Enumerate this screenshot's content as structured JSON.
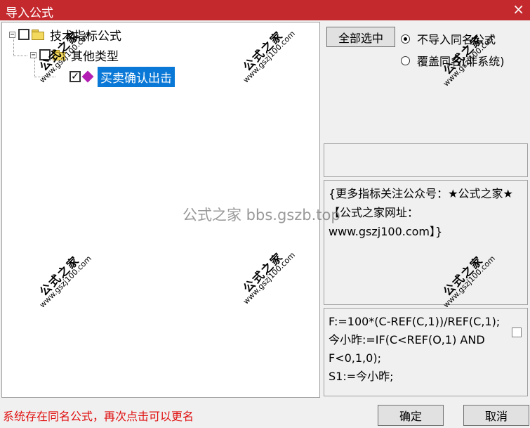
{
  "window": {
    "title": "导入公式",
    "close_glyph": "×"
  },
  "tree": {
    "root": {
      "label": "技术指标公式",
      "expander": "−",
      "checked": false
    },
    "category": {
      "label": "其他类型",
      "expander": "−",
      "checked": false
    },
    "item": {
      "label": "买卖确认出击",
      "checked": true,
      "check_glyph": "✓"
    }
  },
  "buttons": {
    "select_all": "全部选中",
    "ok": "确定",
    "cancel": "取消"
  },
  "radios": {
    "no_import": "不导入同名公式",
    "overwrite": "覆盖同名(非系统)",
    "selected": "no_import"
  },
  "note": {
    "text": "{更多指标关注公众号：★公式之家★【公式之家网址：www.gszj100.com】}"
  },
  "formula": {
    "lines": [
      "F:=100*(C-REF(C,1))/REF(C,1);",
      "今小昨:=IF(C<REF(O,1) AND",
      "F<0,1,0);",
      "S1:=今小昨;"
    ]
  },
  "status": {
    "message": "系统存在同名公式，再次点击可以更名"
  },
  "watermark": {
    "brand": "公式之家",
    "url": "www.gszj100.com",
    "center": "公式之家 bbs.gszb.top"
  },
  "colors": {
    "titlebar": "#c4292e",
    "selection": "#0a78d7",
    "status_text": "#e01010"
  }
}
